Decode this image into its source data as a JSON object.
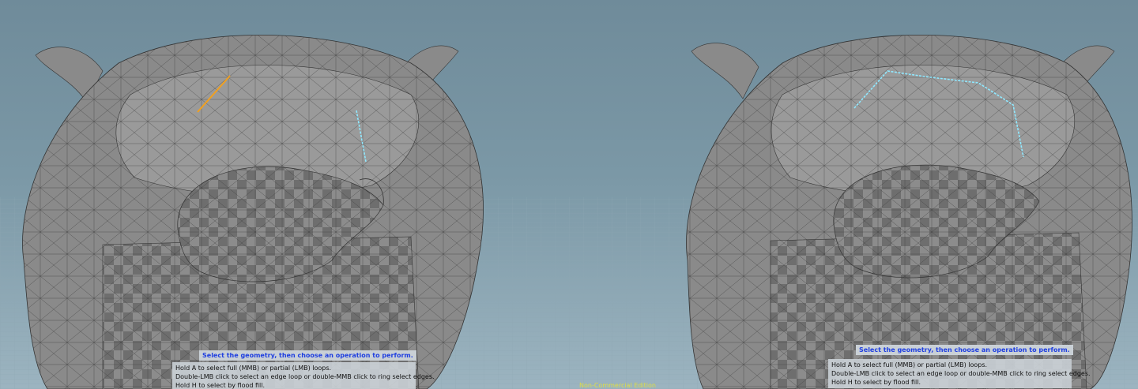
{
  "viewports": [
    {
      "id": "left",
      "selection_hint": "Select the geometry, then choose an operation to perform.",
      "help_lines": [
        "Hold A to select full (MMB) or partial (LMB) loops.",
        "Double-LMB click to select an edge loop or double-MMB click to ring select edges.",
        "Hold H to select by flood fill."
      ]
    },
    {
      "id": "right",
      "selection_hint": "Select the geometry, then choose an operation to perform.",
      "help_lines": [
        "Hold A to select full (MMB) or partial (LMB) loops.",
        "Double-LMB click to select an edge loop or double-MMB click to ring select edges.",
        "Hold H to select by flood fill."
      ]
    }
  ],
  "edition_label": "Non-Commercial Edition",
  "colors": {
    "selected_edge": "#f0a020",
    "highlighted_edge": "#8fe8ff",
    "mesh_fill": "#8a8a8a",
    "hud_title_text": "#1f3fe0",
    "edition_text": "#e6e23a"
  }
}
